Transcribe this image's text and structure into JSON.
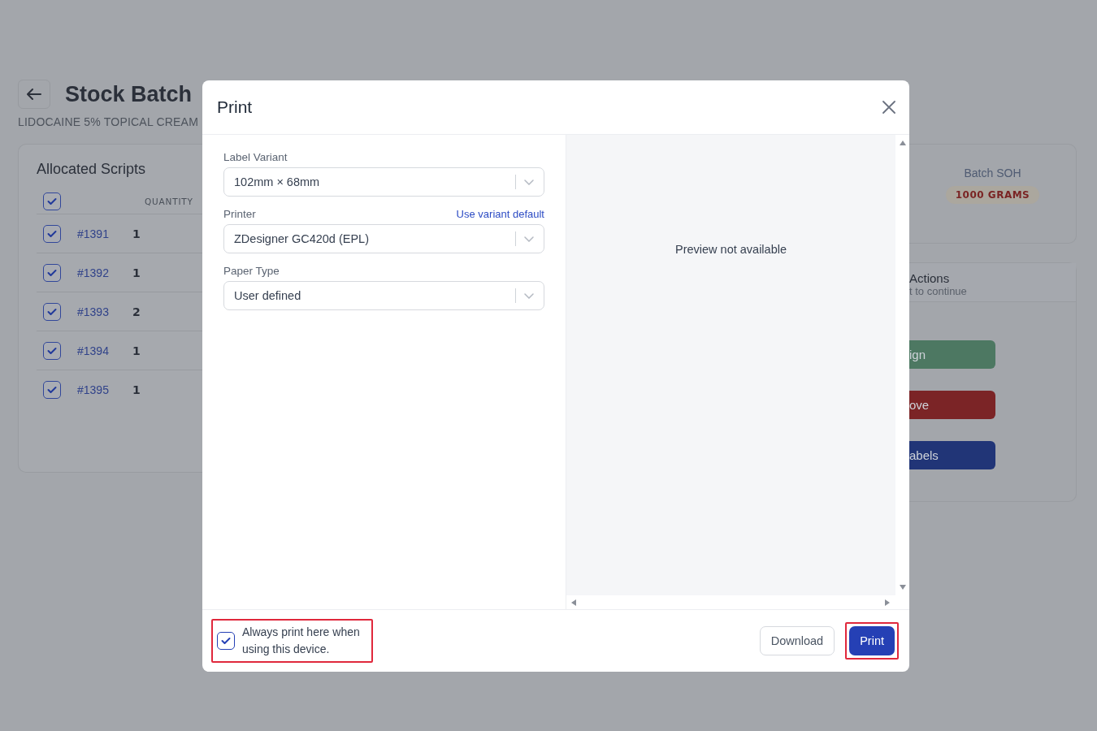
{
  "page": {
    "title": "Stock Batch",
    "subtitle": "LIDOCAINE 5% TOPICAL CREAM",
    "allocated": {
      "title": "Allocated Scripts",
      "select_all_checked": true,
      "columns": [
        "QUANTITY"
      ],
      "rows": [
        {
          "script": "#1391",
          "quantity": "1",
          "checked": true
        },
        {
          "script": "#1392",
          "quantity": "1",
          "checked": true
        },
        {
          "script": "#1393",
          "quantity": "2",
          "checked": true
        },
        {
          "script": "#1394",
          "quantity": "1",
          "checked": true
        },
        {
          "script": "#1395",
          "quantity": "1",
          "checked": true
        }
      ]
    },
    "batch_soh": {
      "label": "Batch SOH",
      "value": "1000 GRAMS"
    },
    "actions": {
      "title": "Actions",
      "subtitle": "t to continue",
      "buttons": [
        {
          "label": "ign",
          "kind": "success"
        },
        {
          "label": "ove",
          "kind": "danger"
        },
        {
          "label": "abels",
          "kind": "primary"
        }
      ]
    }
  },
  "dialog": {
    "title": "Print",
    "fields": [
      {
        "label": "Label Variant",
        "value": "102mm × 68mm"
      },
      {
        "label": "Printer",
        "value": "ZDesigner GC420d (EPL)",
        "link": "Use variant default"
      },
      {
        "label": "Paper Type",
        "value": "User defined"
      }
    ],
    "preview": "Preview not available",
    "remember": {
      "label": "Always print here when using this device.",
      "checked": true
    },
    "buttons": [
      {
        "label": "Download",
        "kind": "secondary"
      },
      {
        "label": "Print",
        "kind": "primary"
      }
    ]
  }
}
